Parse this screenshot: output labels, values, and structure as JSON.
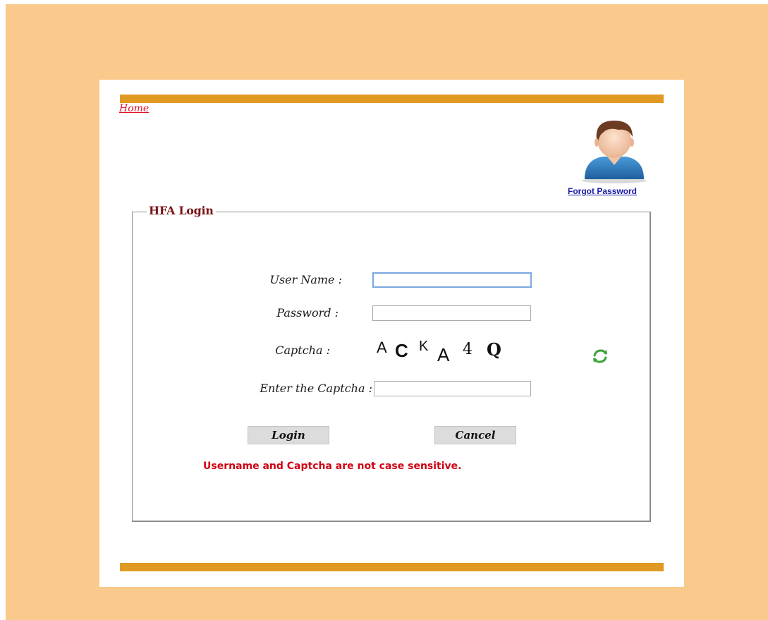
{
  "nav": {
    "home_label": "Home",
    "forgot_password_label": "Forgot Password"
  },
  "avatar": {
    "icon": "user-avatar-icon"
  },
  "login_form": {
    "legend": "HFA Login",
    "username_label": "User Name :",
    "username_value": "",
    "password_label": "Password :",
    "password_value": "",
    "captcha_label": "Captcha :",
    "captcha_chars": [
      "A",
      "C",
      "K",
      "A",
      "4",
      "Q"
    ],
    "captcha_refresh_icon": "refresh-icon",
    "enter_captcha_label": "Enter the Captcha :",
    "enter_captcha_value": "",
    "login_button": "Login",
    "cancel_button": "Cancel",
    "note": "Username and Captcha are not case sensitive."
  },
  "colors": {
    "page_background": "#fac98c",
    "accent_bar": "#e09a24",
    "legend_text": "#7a1518",
    "note_text": "#cf0013",
    "home_link": "#e3112a",
    "forgot_link": "#1a1aa6"
  }
}
